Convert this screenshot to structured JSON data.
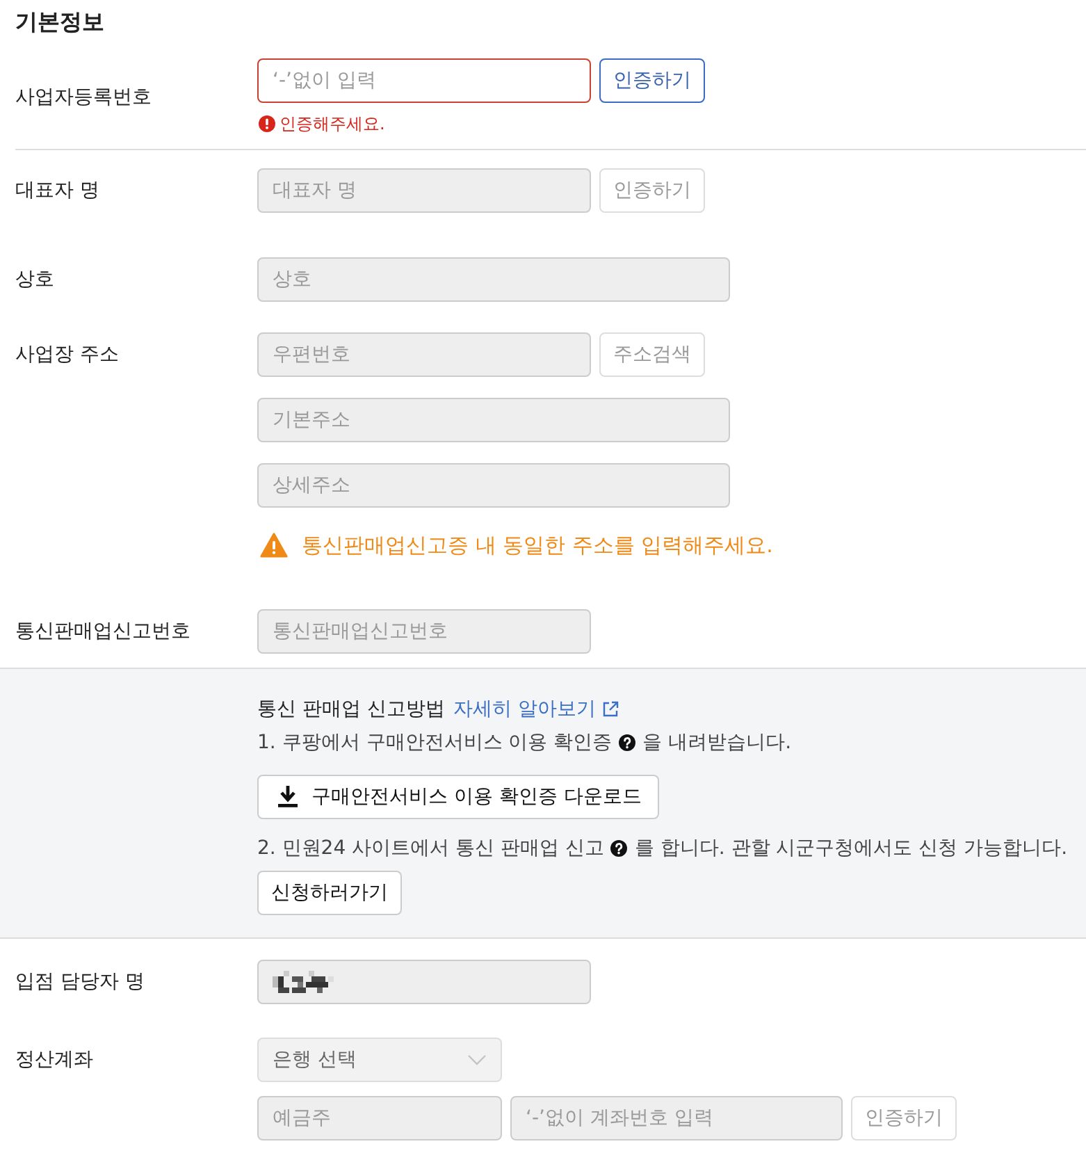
{
  "section": {
    "title": "기본정보"
  },
  "rows": [
    {
      "kind": "field",
      "label": "사업자등록번호",
      "lines": [
        [
          {
            "kind": "input",
            "placeholder": "‘-’없이 입력",
            "disabled": false,
            "invalid": true
          },
          {
            "kind": "button",
            "label": "인증하기",
            "primary": true,
            "disabled": false
          }
        ]
      ],
      "message": {
        "kind": "error",
        "text": "인증해주세요."
      }
    },
    {
      "kind": "divider"
    },
    {
      "kind": "field",
      "label": "대표자 명",
      "lines": [
        [
          {
            "kind": "input",
            "placeholder": "대표자 명",
            "disabled": true,
            "invalid": false
          },
          {
            "kind": "button",
            "label": "인증하기",
            "primary": false,
            "disabled": true
          }
        ]
      ]
    },
    {
      "kind": "field",
      "label": "상호",
      "lines": [
        [
          {
            "kind": "input",
            "placeholder": "상호",
            "disabled": true,
            "invalid": false
          }
        ]
      ]
    },
    {
      "kind": "field",
      "label": "사업장 주소",
      "lines": [
        [
          {
            "kind": "input",
            "placeholder": "우편번호",
            "disabled": true,
            "invalid": false
          },
          {
            "kind": "button",
            "label": "주소검색",
            "primary": false,
            "disabled": true
          }
        ],
        [
          {
            "kind": "input",
            "placeholder": "기본주소",
            "disabled": true,
            "invalid": false
          }
        ],
        [
          {
            "kind": "input",
            "placeholder": "상세주소",
            "disabled": true,
            "invalid": false
          }
        ]
      ],
      "message": {
        "kind": "warning",
        "text": "통신판매업신고증 내 동일한 주소를 입력해주세요."
      }
    },
    {
      "kind": "field",
      "label": "통신판매업신고번호",
      "lines": [
        [
          {
            "kind": "input",
            "placeholder": "통신판매업신고번호",
            "disabled": true,
            "invalid": false
          }
        ]
      ]
    },
    {
      "kind": "guide",
      "heading": "통신 판매업 신고방법",
      "link": "자세히 알아보기",
      "steps": [
        {
          "text": "1. 쿠팡에서 구매안전서비스 이용 확인증",
          "text_after": "을 내려받습니다.",
          "button": {
            "kind": "download",
            "label": "구매안전서비스 이용 확인증 다운로드"
          }
        },
        {
          "text": "2. 민원24 사이트에서 통신 판매업 신고",
          "text_after": "를 합니다. 관할 시군구청에서도 신청 가능합니다.",
          "button": {
            "kind": "plain",
            "label": "신청하러가기"
          }
        }
      ]
    },
    {
      "kind": "field",
      "label": "입점 담당자 명",
      "lines": [
        [
          {
            "kind": "input",
            "redacted": true,
            "disabled": true,
            "invalid": false
          }
        ]
      ]
    },
    {
      "kind": "field",
      "label": "정산계좌",
      "lines": [
        [
          {
            "kind": "select",
            "value": "은행 선택",
            "disabled": true
          }
        ],
        [
          {
            "kind": "input",
            "placeholder": "예금주",
            "disabled": true,
            "invalid": false
          },
          {
            "kind": "input",
            "placeholder": "‘-’없이 계좌번호 입력",
            "disabled": true,
            "invalid": false
          },
          {
            "kind": "button",
            "label": "인증하기",
            "primary": false,
            "disabled": true
          }
        ]
      ]
    }
  ]
}
